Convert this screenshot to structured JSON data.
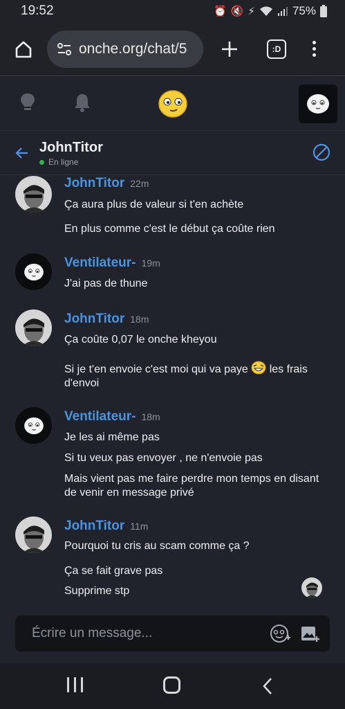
{
  "status_bar": {
    "time": "19:52",
    "battery": "75%",
    "icons": [
      "alarm-icon",
      "mute-icon",
      "data-saver-icon",
      "wifi-icon",
      "signal-icon",
      "battery-icon"
    ]
  },
  "browser": {
    "url": "onche.org/chat/5",
    "tabs_label": ":D",
    "icons": [
      "home-icon",
      "site-settings-icon",
      "plus-icon",
      "tabs-icon",
      "menu-dots-icon"
    ]
  },
  "app_nav": {
    "icons": [
      "lightbulb-icon",
      "bell-icon",
      "onche-logo",
      "profile-avatar"
    ]
  },
  "chat": {
    "partner_name": "JohnTitor",
    "partner_status": "En ligne",
    "accent": "#4a93e0",
    "online_color": "#37b24d"
  },
  "messages": [
    {
      "author": "JohnTitor",
      "time": "22m",
      "avatar": "photo",
      "lines": [
        "Ça aura plus de valeur si t'en achète",
        "En plus comme c'est le début ça coûte rien"
      ]
    },
    {
      "author": "Ventilateur-",
      "time": "19m",
      "avatar": "onche",
      "lines": [
        "J'ai pas de thune"
      ]
    },
    {
      "author": "JohnTitor",
      "time": "18m",
      "avatar": "photo",
      "lines": [
        "Ça coûte 0,07 le onche kheyou",
        "Si je t'en envoie c'est moi qui va paye",
        "les frais d'envoi"
      ]
    },
    {
      "author": "Ventilateur-",
      "time": "18m",
      "avatar": "onche",
      "lines": [
        "Je les ai même pas",
        "Si tu veux pas envoyer , ne n'envoie pas",
        "Mais vient pas me faire perdre mon temps en disant de venir en message privé"
      ]
    },
    {
      "author": "JohnTitor",
      "time": "11m",
      "avatar": "photo",
      "lines": [
        "Pourquoi tu cris au scam comme ça ?",
        "Ça se fait grave pas",
        "Supprime stp"
      ]
    }
  ],
  "composer": {
    "placeholder": "Écrire un message..."
  }
}
